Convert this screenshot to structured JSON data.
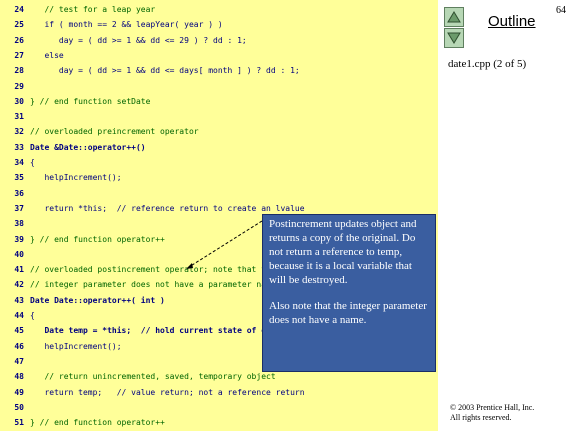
{
  "slide": {
    "number": "64",
    "outline_label": "Outline",
    "file_label": "date1.cpp (2 of 5)",
    "copyright_line1": "© 2003 Prentice Hall, Inc.",
    "copyright_line2": "All rights reserved."
  },
  "code_lines": [
    {
      "n": "24",
      "text": "   // test for a leap year"
    },
    {
      "n": "25",
      "text": "   if ( month == 2 && leapYear( year ) )"
    },
    {
      "n": "26",
      "text": "      day = ( dd >= 1 && dd <= 29 ) ? dd : 1;"
    },
    {
      "n": "27",
      "text": "   else"
    },
    {
      "n": "28",
      "text": "      day = ( dd >= 1 && dd <= days[ month ] ) ? dd : 1;"
    },
    {
      "n": "29",
      "text": ""
    },
    {
      "n": "30",
      "text": "} // end function setDate"
    },
    {
      "n": "31",
      "text": ""
    },
    {
      "n": "32",
      "text": "// overloaded preincrement operator"
    },
    {
      "n": "33",
      "text": "Date &Date::operator++()"
    },
    {
      "n": "34",
      "text": "{"
    },
    {
      "n": "35",
      "text": "   helpIncrement();"
    },
    {
      "n": "36",
      "text": ""
    },
    {
      "n": "37",
      "text": "   return *this;  // reference return to create an lvalue"
    },
    {
      "n": "38",
      "text": ""
    },
    {
      "n": "39",
      "text": "} // end function operator++"
    },
    {
      "n": "40",
      "text": ""
    },
    {
      "n": "41",
      "text": "// overloaded postincrement operator; note that the dummy"
    },
    {
      "n": "42",
      "text": "// integer parameter does not have a parameter name"
    },
    {
      "n": "43",
      "text": "Date Date::operator++( int )"
    },
    {
      "n": "44",
      "text": "{"
    },
    {
      "n": "45",
      "text": "   Date temp = *this;  // hold current state of object"
    },
    {
      "n": "46",
      "text": "   helpIncrement();"
    },
    {
      "n": "47",
      "text": ""
    },
    {
      "n": "48",
      "text": "   // return unincremented, saved, temporary object"
    },
    {
      "n": "49",
      "text": "   return temp;   // value return; not a reference return"
    },
    {
      "n": "50",
      "text": ""
    },
    {
      "n": "51",
      "text": "} // end function operator++"
    }
  ],
  "callout": {
    "para1": "Postincrement updates object and returns a copy of the original. Do not return a reference to temp, because it is a local variable that will be destroyed.",
    "para2": "Also note that the integer parameter does not have a name."
  },
  "icons": {
    "up": "triangle-up-icon",
    "down": "triangle-down-icon"
  },
  "colors": {
    "code_background": "#ffff99",
    "callout_background": "#3a5ea0",
    "nav_button": "#b7d7b5"
  }
}
